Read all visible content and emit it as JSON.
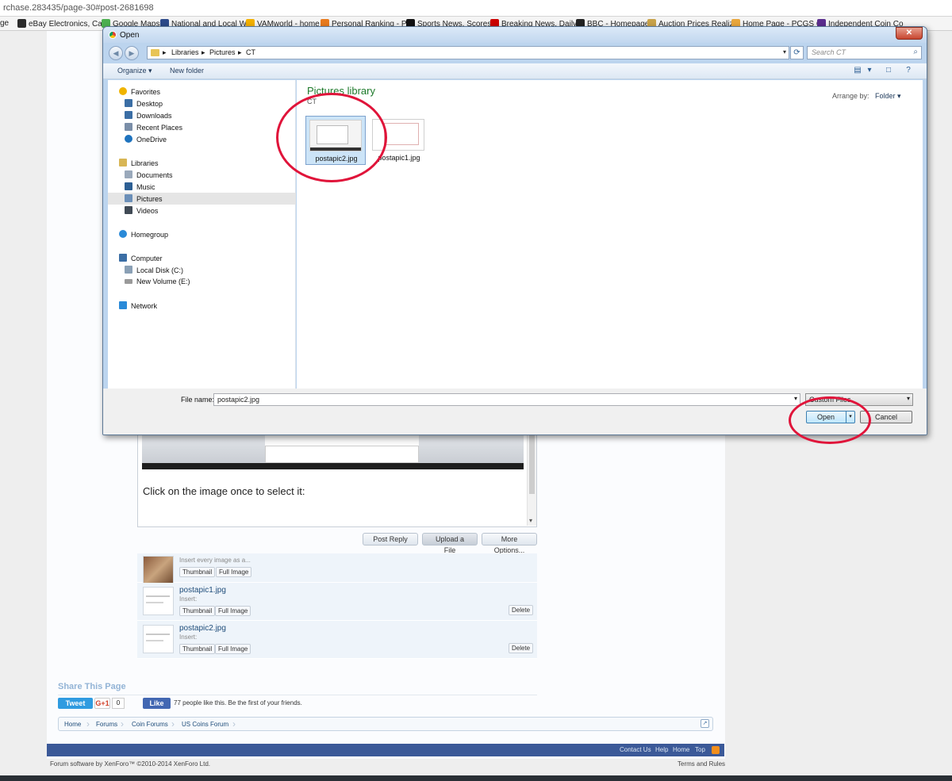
{
  "browser": {
    "url": "rchase.283435/page-30#post-2681698",
    "bookmarks": [
      {
        "label": "ge",
        "color": "#ffffff"
      },
      {
        "label": "eBay Electronics, Car",
        "color": "#2b2b2b"
      },
      {
        "label": "Google Maps",
        "color": "#4caf50"
      },
      {
        "label": "National and Local W",
        "color": "#2c4a8a"
      },
      {
        "label": "VAMworld - home",
        "color": "#f2b000"
      },
      {
        "label": "Personal Ranking - Pk",
        "color": "#e87a1d"
      },
      {
        "label": "Sports News, Scores",
        "color": "#111111"
      },
      {
        "label": "Breaking News, Daily",
        "color": "#cc0000"
      },
      {
        "label": "BBC - Homepage",
        "color": "#222222"
      },
      {
        "label": "Auction Prices Realiz",
        "color": "#c8a24a"
      },
      {
        "label": "Home Page - PCGS C",
        "color": "#e8a63c"
      },
      {
        "label": "Independent Coin Co",
        "color": "#5b2d8e"
      }
    ]
  },
  "dialog": {
    "title": "Open",
    "close_glyph": "✕",
    "breadcrumb": [
      "Libraries",
      "Pictures",
      "CT"
    ],
    "search_placeholder": "Search CT",
    "toolbar": {
      "organize": "Organize ▾",
      "new_folder": "New folder"
    },
    "nav": [
      {
        "label": "Favorites",
        "icon": "star-icon",
        "color": "#f0b400"
      },
      {
        "label": "Desktop",
        "icon": "desktop-icon",
        "color": "#3b6ea5"
      },
      {
        "label": "Downloads",
        "icon": "downloads-icon",
        "color": "#3b6ea5"
      },
      {
        "label": "Recent Places",
        "icon": "recent-places-icon",
        "color": "#7a8ea8"
      },
      {
        "label": "OneDrive",
        "icon": "cloud-icon",
        "color": "#1e73be"
      },
      {
        "label": "Libraries",
        "icon": "libraries-icon",
        "color": "#d8b655"
      },
      {
        "label": "Documents",
        "icon": "documents-icon",
        "color": "#9aa9bb"
      },
      {
        "label": "Music",
        "icon": "music-icon",
        "color": "#2d5f94"
      },
      {
        "label": "Pictures",
        "icon": "pictures-icon",
        "color": "#6b8fb8"
      },
      {
        "label": "Videos",
        "icon": "videos-icon",
        "color": "#404a55"
      },
      {
        "label": "Homegroup",
        "icon": "homegroup-icon",
        "color": "#2a8ad8"
      },
      {
        "label": "Computer",
        "icon": "computer-icon",
        "color": "#3b6ea5"
      },
      {
        "label": "Local Disk (C:)",
        "icon": "disk-icon",
        "color": "#8aa0b5"
      },
      {
        "label": "New Volume (E:)",
        "icon": "disk-icon",
        "color": "#9a9a9a"
      },
      {
        "label": "Network",
        "icon": "network-icon",
        "color": "#2a8ad8"
      }
    ],
    "library_title": "Pictures library",
    "library_sub": "CT",
    "arrange_label": "Arrange by:",
    "arrange_value": "Folder ▾",
    "files": [
      "postapic2.jpg",
      "postapic1.jpg"
    ],
    "filename_label": "File name:",
    "filename_value": "postapic2.jpg",
    "filetype_value": "Custom Files",
    "open_label": "Open",
    "cancel_label": "Cancel",
    "annotation_color": "#e0143a"
  },
  "forum": {
    "editor_text": "Click on the image once to select it:",
    "post_reply": "Post Reply",
    "upload_file": "Upload a File",
    "more_options": "More Options...",
    "insert_every": "Insert every image as a...",
    "insert_label": "Insert:",
    "thumbnail_label": "Thumbnail",
    "full_image_label": "Full Image",
    "delete_label": "Delete",
    "attachments": [
      "postapic1.jpg",
      "postapic2.jpg"
    ],
    "share_title": "Share This Page",
    "tweet": "Tweet",
    "gplus": "G+1",
    "gplus_count": "0",
    "fb_like": "Like",
    "fb_text": "77 people like this. Be the first of your friends.",
    "breadcrumbs": [
      "Home",
      "Forums",
      "Coin Forums",
      "US Coins Forum"
    ],
    "footer_links": [
      "Contact Us",
      "Help",
      "Home",
      "Top"
    ],
    "copyright": "Forum software by XenForo™ ©2010-2014 XenForo Ltd.",
    "terms": "Terms and Rules"
  }
}
